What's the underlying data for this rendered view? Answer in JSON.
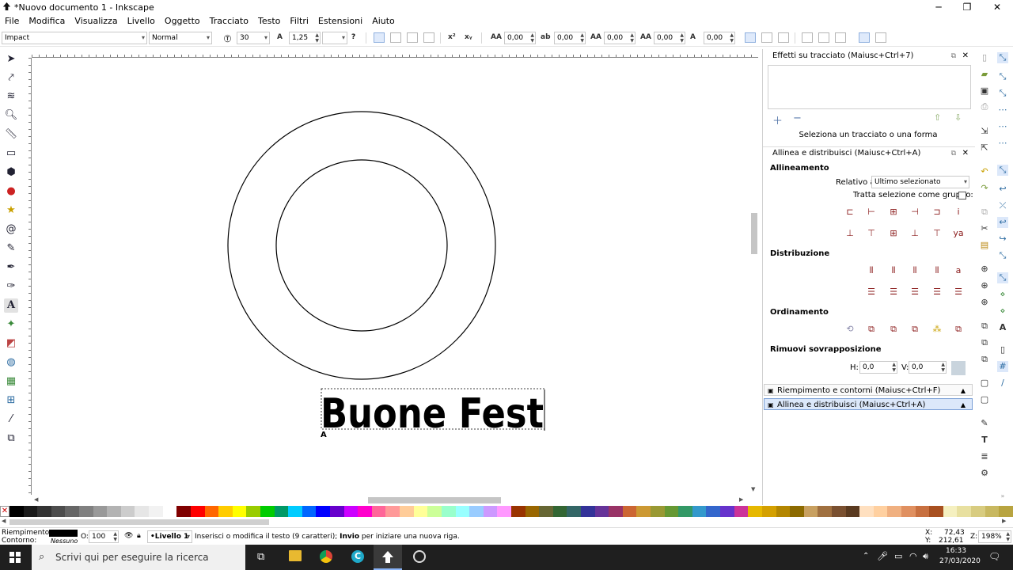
{
  "window": {
    "title": "*Nuovo documento 1 - Inkscape"
  },
  "menu": [
    "File",
    "Modifica",
    "Visualizza",
    "Livello",
    "Oggetto",
    "Tracciato",
    "Testo",
    "Filtri",
    "Estensioni",
    "Aiuto"
  ],
  "text_toolbar": {
    "font_family": "Impact",
    "font_style": "Normal",
    "font_size": "30",
    "line_spacing": "1,25",
    "letter_spacing": "0,00",
    "word_spacing": "0,00",
    "kerning": "0,00",
    "vertical_shift": "0,00",
    "rotation": "0,00"
  },
  "canvas_text": "Buone Fest",
  "path_effects": {
    "header": "Effetti su tracciato (Maiusc+Ctrl+7)",
    "hint": "Seleziona un tracciato o una forma"
  },
  "align": {
    "header": "Allinea e distribuisci (Maiusc+Ctrl+A)",
    "section_align": "Allineamento",
    "relative_label": "Relativo a:",
    "relative_value": "Ultimo selezionato",
    "group_label": "Tratta selezione come gruppo:",
    "section_distribute": "Distribuzione",
    "section_order": "Ordinamento",
    "section_overlap": "Rimuovi sovrapposizione",
    "h_label": "H:",
    "h_value": "0,0",
    "v_label": "V:",
    "v_value": "0,0"
  },
  "collapsed_panels": [
    "Riempimento e contorni (Maiusc+Ctrl+F)",
    "Allinea e distribuisci (Maiusc+Ctrl+A)"
  ],
  "status": {
    "fill_label": "Riempimento:",
    "stroke_label": "Contorno:",
    "stroke_value": "Nessuno",
    "opacity_label": "O:",
    "opacity_value": "100",
    "layer": "•Livello 1",
    "message_prefix": "Inserisci o modifica il testo (9 caratteri);",
    "message_key": "Invio",
    "message_suffix": "per iniziare una nuova riga.",
    "x_label": "X:",
    "x_value": "72,43",
    "y_label": "Y:",
    "y_value": "212,61",
    "zoom_label": "Z:",
    "zoom_value": "198%"
  },
  "taskbar": {
    "search_placeholder": "Scrivi qui per eseguire la ricerca",
    "time": "16:33",
    "date": "27/03/2020"
  },
  "palette": [
    "#000000",
    "#1a1a1a",
    "#333333",
    "#4d4d4d",
    "#666666",
    "#808080",
    "#999999",
    "#b3b3b3",
    "#cccccc",
    "#e6e6e6",
    "#f2f2f2",
    "#ffffff",
    "#800000",
    "#ff0000",
    "#ff6600",
    "#ffcc00",
    "#ffff00",
    "#99cc00",
    "#00cc00",
    "#009966",
    "#00ccff",
    "#0066ff",
    "#0000ff",
    "#6600cc",
    "#cc00ff",
    "#ff00cc",
    "#ff6699",
    "#ff9999",
    "#ffcc99",
    "#ffff99",
    "#ccff99",
    "#99ffcc",
    "#99ffff",
    "#99ccff",
    "#cc99ff",
    "#ff99ff",
    "#993300",
    "#996600",
    "#666633",
    "#336633",
    "#336666",
    "#333399",
    "#663399",
    "#993366",
    "#cc6633",
    "#cc9933",
    "#999933",
    "#669933",
    "#339966",
    "#3399cc",
    "#3366cc",
    "#6633cc",
    "#cc3399",
    "#e6b800",
    "#d4a000",
    "#b38600",
    "#8c6a00",
    "#c8a060",
    "#a07040",
    "#7a5030",
    "#5a3a20",
    "#ffe0c0",
    "#ffd0a0",
    "#f0b080",
    "#e09060",
    "#c87040",
    "#a85020",
    "#f5f0c0",
    "#e8e0a0",
    "#d8cc80",
    "#c8b860",
    "#b8a440"
  ]
}
